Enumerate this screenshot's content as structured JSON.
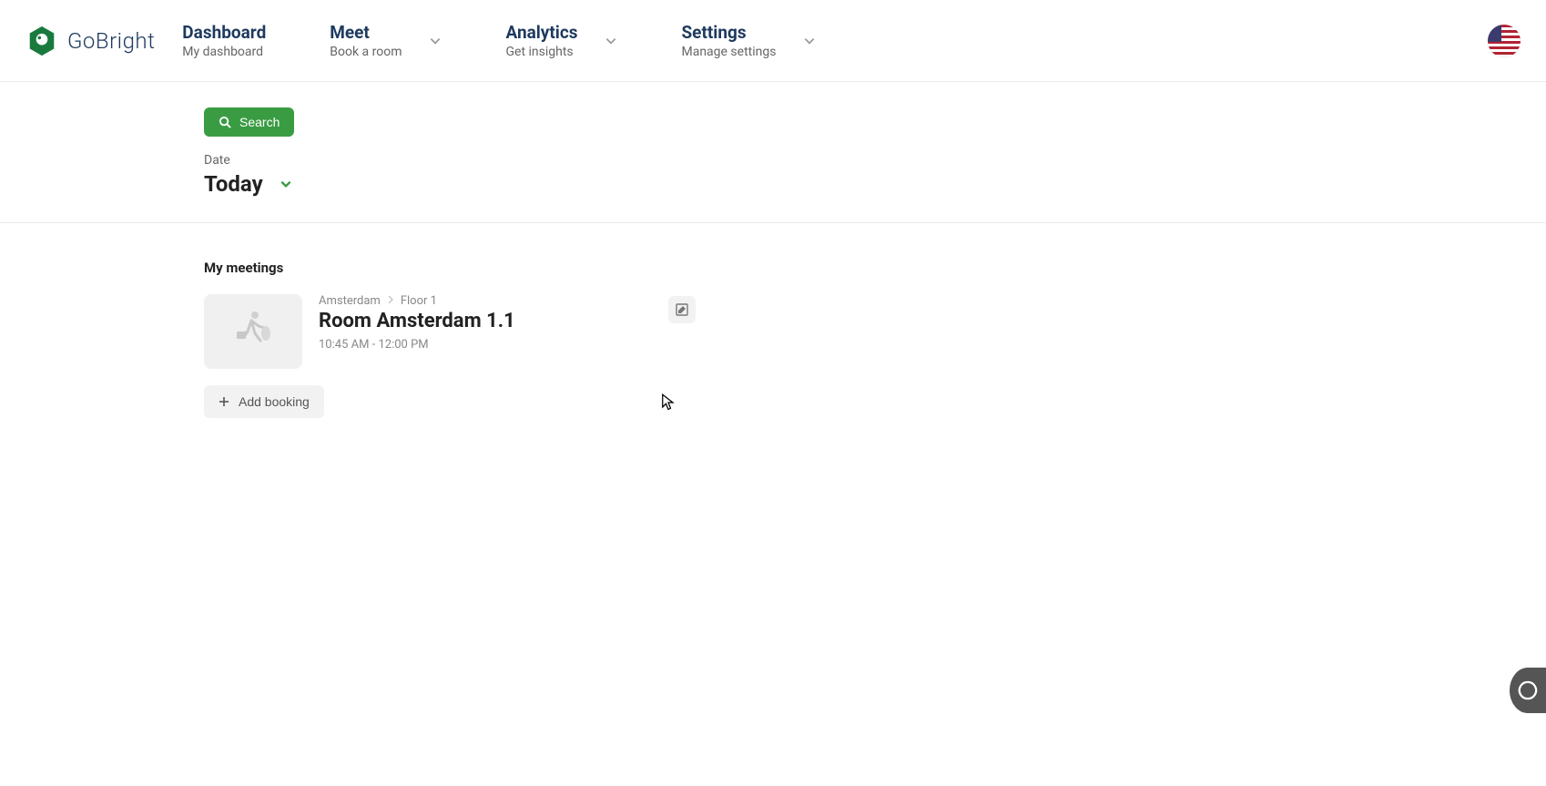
{
  "brand": {
    "name": "GoBright"
  },
  "nav": {
    "items": [
      {
        "title": "Dashboard",
        "subtitle": "My dashboard",
        "hasDropdown": false
      },
      {
        "title": "Meet",
        "subtitle": "Book a room",
        "hasDropdown": true
      },
      {
        "title": "Analytics",
        "subtitle": "Get insights",
        "hasDropdown": true
      },
      {
        "title": "Settings",
        "subtitle": "Manage settings",
        "hasDropdown": true
      }
    ]
  },
  "search": {
    "label": "Search"
  },
  "date": {
    "label": "Date",
    "value": "Today"
  },
  "meetings": {
    "heading": "My meetings",
    "items": [
      {
        "locationPath": [
          "Amsterdam",
          "Floor 1"
        ],
        "roomName": "Room Amsterdam 1.1",
        "timeRange": "10:45 AM - 12:00 PM"
      }
    ]
  },
  "addBooking": {
    "label": "Add booking"
  },
  "locale": {
    "flag": "US"
  }
}
